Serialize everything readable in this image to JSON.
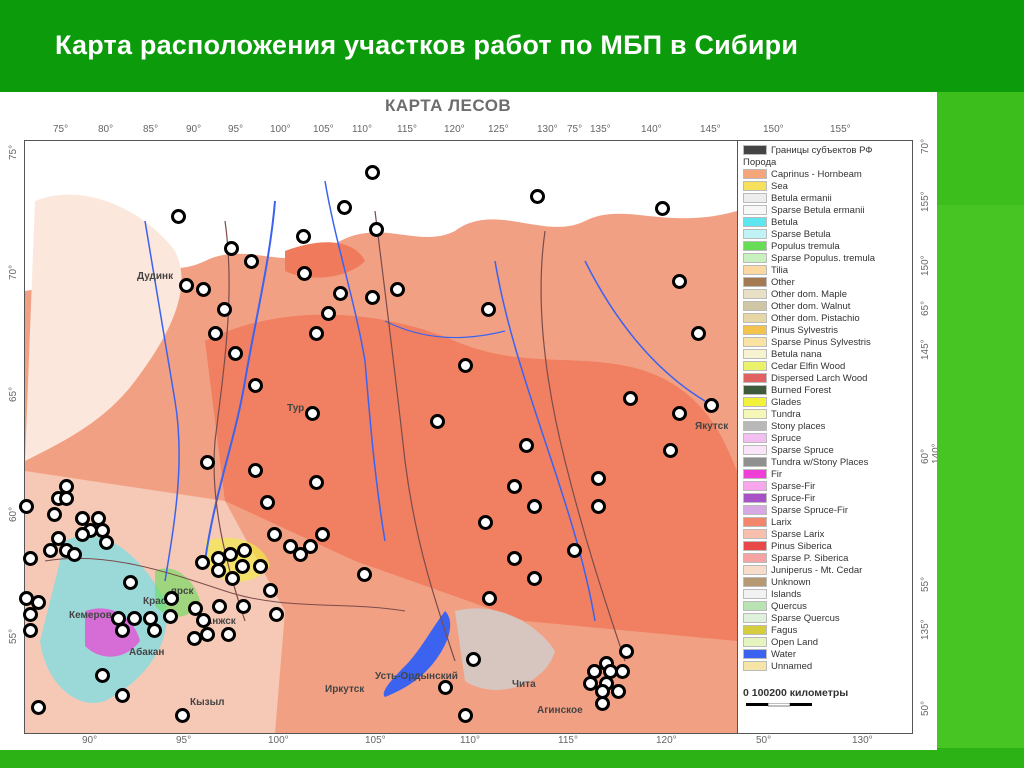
{
  "slide": {
    "title": "Карта расположения участков работ по МБП в Сибири"
  },
  "map": {
    "title": "КАРТА ЛЕСОВ",
    "top_degrees": [
      "75°",
      "80°",
      "85°",
      "90°",
      "95°",
      "100°",
      "105°",
      "110°",
      "115°",
      "120°",
      "125°",
      "130°",
      "75°",
      "135°",
      "140°",
      "145°",
      "150°",
      "155°"
    ],
    "bottom_degrees": [
      "90°",
      "95°",
      "100°",
      "105°",
      "110°",
      "115°",
      "120°",
      "50°",
      "130°"
    ],
    "left_degrees": [
      "75°",
      "70°",
      "65°",
      "60°",
      "55°"
    ],
    "right_degrees": [
      "70°",
      "155°",
      "150°",
      "65°",
      "145°",
      "60° 140°",
      "55°",
      "135°",
      "50°"
    ],
    "cities": [
      "Дудинк",
      "Тур",
      "Якутск",
      "Кемеров",
      "Крас",
      "Абакан",
      "Иркутск",
      "Усть-Ордынский",
      "Чита",
      "Агинское",
      "Кызыл",
      "Анжск",
      "ярск"
    ],
    "legend": {
      "items": [
        {
          "label": "Границы субъектов РФ",
          "color": "#444444"
        },
        {
          "label": "Порода",
          "color": ""
        },
        {
          "label": "Caprinus - Hornbeam",
          "color": "#f4a57a"
        },
        {
          "label": "Sea",
          "color": "#f6e05c"
        },
        {
          "label": "Betula ermanii",
          "color": "#ededed"
        },
        {
          "label": "Sparse Betula ermanii",
          "color": "#f7f7f7"
        },
        {
          "label": "Betula",
          "color": "#5fe5ef"
        },
        {
          "label": "Sparse Betula",
          "color": "#bff3f6"
        },
        {
          "label": "Populus tremula",
          "color": "#66dd55"
        },
        {
          "label": "Sparse Populus. tremula",
          "color": "#c9f1bf"
        },
        {
          "label": "Tilia",
          "color": "#fcd9a0"
        },
        {
          "label": "Other",
          "color": "#a47a52"
        },
        {
          "label": "Other dom. Maple",
          "color": "#e7e0c4"
        },
        {
          "label": "Other dom. Walnut",
          "color": "#cfc6a4"
        },
        {
          "label": "Other dom. Pistachio",
          "color": "#e8d7a6"
        },
        {
          "label": "Pinus Sylvestris",
          "color": "#f3c34d"
        },
        {
          "label": "Sparse Pinus Sylvestris",
          "color": "#f9e2a2"
        },
        {
          "label": "Betula nana",
          "color": "#f7f3d0"
        },
        {
          "label": "Cedar Elfin Wood",
          "color": "#e9f26a"
        },
        {
          "label": "Dispersed Larch Wood",
          "color": "#e26161"
        },
        {
          "label": "Burned Forest",
          "color": "#3d5a3a"
        },
        {
          "label": "Glades",
          "color": "#f2f23b"
        },
        {
          "label": "Tundra",
          "color": "#f4f7b5"
        },
        {
          "label": "Stony places",
          "color": "#b8b8b8"
        },
        {
          "label": "Spruce",
          "color": "#f3bff0"
        },
        {
          "label": "Sparse Spruce",
          "color": "#f9e4f8"
        },
        {
          "label": "Tundra w/Stony Places",
          "color": "#909090"
        },
        {
          "label": "Fir",
          "color": "#ef3fd6"
        },
        {
          "label": "Sparse-Fir",
          "color": "#f7a6ec"
        },
        {
          "label": "Spruce-Fir",
          "color": "#a951c7"
        },
        {
          "label": "Sparse Spruce-Fir",
          "color": "#d7a8e4"
        },
        {
          "label": "Larix",
          "color": "#f2866a"
        },
        {
          "label": "Sparse Larix",
          "color": "#f8c0ac"
        },
        {
          "label": "Pinus Siberica",
          "color": "#e84848"
        },
        {
          "label": "Sparse P. Siberica",
          "color": "#f6a3a3"
        },
        {
          "label": "Juniperus - Mt. Cedar",
          "color": "#f7dcc9"
        },
        {
          "label": "Unknown",
          "color": "#b69a74"
        },
        {
          "label": "Islands",
          "color": "#f2f2f2"
        },
        {
          "label": "Quercus",
          "color": "#b9e3b2"
        },
        {
          "label": "Sparse Quercus",
          "color": "#dff1db"
        },
        {
          "label": "Fagus",
          "color": "#d5cc3e"
        },
        {
          "label": "Open Land",
          "color": "#e6f5bf"
        },
        {
          "label": "Water",
          "color": "#3b63f0"
        },
        {
          "label": "Unnamed",
          "color": "#f5e6a8"
        }
      ],
      "scale": "0  100200  километры"
    }
  },
  "colors": {
    "slide_bg": "#0a9a0a",
    "title_text": "#ffffff",
    "larix": "#f2866a",
    "water": "#3b63f0",
    "marker_ring": "#000000"
  }
}
